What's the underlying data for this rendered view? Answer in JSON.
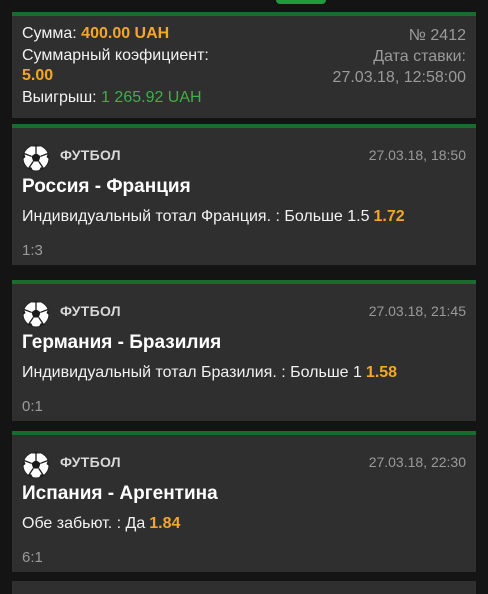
{
  "summary": {
    "stake_label": "Сумма:",
    "stake_value": "400.00 UAH",
    "coef_label": "Суммарный коэфициент:",
    "coef_value": "5.00",
    "win_label": "Выигрыш:",
    "win_value": "1 265.92 UAH",
    "bet_number": "№ 2412",
    "bet_date_label": "Дата ставки:",
    "bet_date_value": "27.03.18, 12:58:00"
  },
  "events": [
    {
      "sport": "ФУТБОЛ",
      "datetime": "27.03.18, 18:50",
      "match": "Россия - Франция",
      "market": "Индивидуальный тотал Франция. : Больше 1.5",
      "odd": "1.72",
      "score": "1:3"
    },
    {
      "sport": "ФУТБОЛ",
      "datetime": "27.03.18, 21:45",
      "match": "Германия - Бразилия",
      "market": "Индивидуальный тотал Бразилия. : Больше 1",
      "odd": "1.58",
      "score": "0:1"
    },
    {
      "sport": "ФУТБОЛ",
      "datetime": "27.03.18, 22:30",
      "match": "Испания - Аргентина",
      "market": "Обе забьют. : Да",
      "odd": "1.84",
      "score": "6:1"
    }
  ],
  "colors": {
    "accent_green": "#196b2e",
    "odd_orange": "#f5a623",
    "win_green": "#3fae4b",
    "card_bg": "#2f2f2f"
  },
  "icons": {
    "sport_icon": "soccer-ball-icon"
  }
}
